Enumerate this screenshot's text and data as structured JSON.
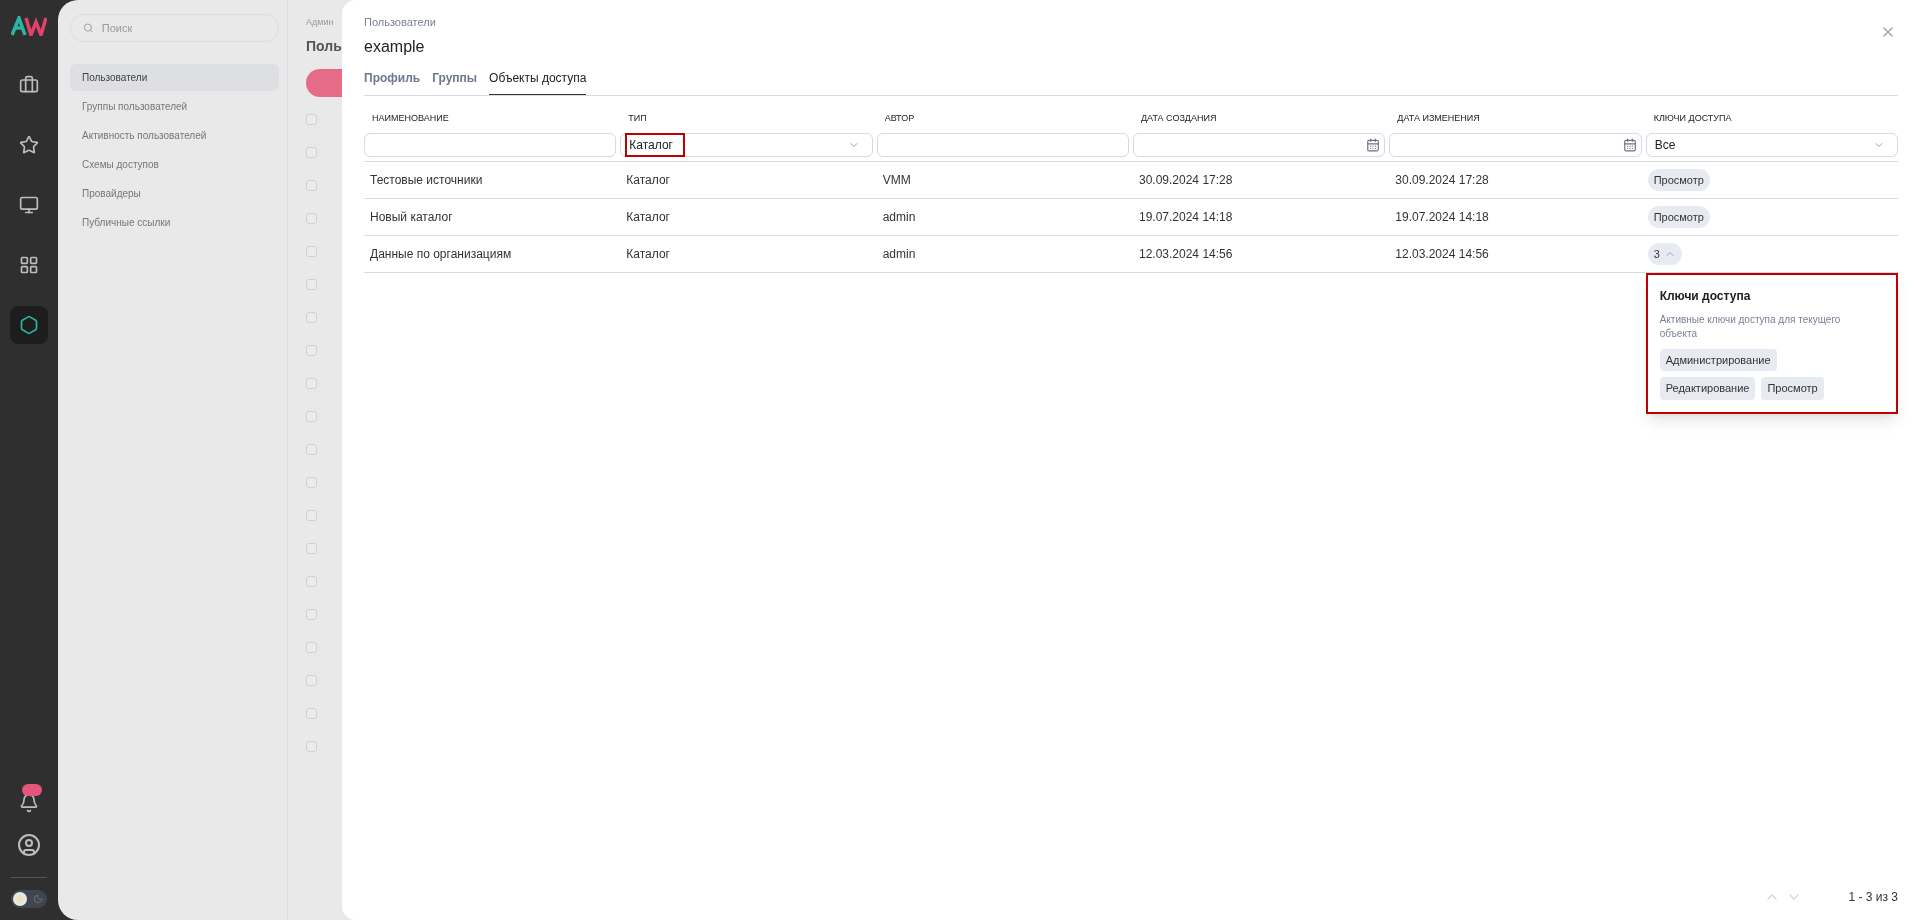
{
  "rail": {
    "items": [
      {
        "kind": "briefcase",
        "selected": false
      },
      {
        "kind": "star",
        "selected": false
      },
      {
        "kind": "screen",
        "selected": false
      },
      {
        "kind": "grid",
        "selected": false
      },
      {
        "kind": "hexagon",
        "selected": true
      }
    ]
  },
  "sidebar": {
    "search": {
      "placeholder": "Поиск"
    },
    "items": [
      {
        "label": "Пользователи",
        "selected": true
      },
      {
        "label": "Группы пользователей",
        "selected": false
      },
      {
        "label": "Активность пользователей",
        "selected": false
      },
      {
        "label": "Схемы доступов",
        "selected": false
      },
      {
        "label": "Провайдеры",
        "selected": false
      },
      {
        "label": "Публичные ссылки",
        "selected": false
      }
    ]
  },
  "theme_toggle": {
    "on": false
  },
  "background_page": {
    "breadcrumb": "Админ",
    "title": "Поль",
    "checkboxes": [
      {
        "checked": false
      },
      {
        "checked": false
      },
      {
        "checked": false
      },
      {
        "checked": false
      },
      {
        "checked": false
      },
      {
        "checked": false
      },
      {
        "checked": false
      },
      {
        "checked": false
      },
      {
        "checked": false
      },
      {
        "checked": false
      },
      {
        "checked": false
      },
      {
        "checked": false
      },
      {
        "checked": false
      },
      {
        "checked": false
      },
      {
        "checked": false
      },
      {
        "checked": false
      },
      {
        "checked": false
      },
      {
        "checked": false
      },
      {
        "checked": false
      },
      {
        "checked": false
      }
    ]
  },
  "drawer": {
    "breadcrumb": "Пользователи",
    "title": "example",
    "tabs": [
      {
        "label": "Профиль",
        "selected": false
      },
      {
        "label": "Группы",
        "selected": false
      },
      {
        "label": "Объекты доступа",
        "selected": true
      }
    ],
    "table": {
      "columns": [
        {
          "label": "НАИМЕНОВАНИЕ",
          "filter": {
            "kind": "text"
          }
        },
        {
          "label": "ТИП",
          "filter": {
            "kind": "select",
            "value": "Каталог",
            "highlighted": true
          }
        },
        {
          "label": "АВТОР",
          "filter": {
            "kind": "text"
          }
        },
        {
          "label": "ДАТА СОЗДАНИЯ",
          "filter": {
            "kind": "date"
          }
        },
        {
          "label": "ДАТА ИЗМЕНЕНИЯ",
          "filter": {
            "kind": "date"
          }
        },
        {
          "label": "КЛЮЧИ ДОСТУПА",
          "filter": {
            "kind": "select",
            "value": "Все",
            "highlighted": false
          }
        }
      ],
      "rows": [
        {
          "cells": [
            "Тестовые источники",
            "Каталог",
            "VMM",
            "30.09.2024 17:28",
            "30.09.2024 17:28"
          ],
          "keys": {
            "kind": "tags",
            "tags": [
              "Просмотр"
            ]
          }
        },
        {
          "cells": [
            "Новый каталог",
            "Каталог",
            "admin",
            "19.07.2024 14:18",
            "19.07.2024 14:18"
          ],
          "keys": {
            "kind": "tags",
            "tags": [
              "Просмотр"
            ]
          }
        },
        {
          "cells": [
            "Данные по организациям",
            "Каталог",
            "admin",
            "12.03.2024 14:56",
            "12.03.2024 14:56"
          ],
          "keys": {
            "kind": "count",
            "count": "3",
            "expanded": true
          }
        }
      ]
    },
    "popover": {
      "title": "Ключи доступа",
      "description": "Активные ключи доступа для текущего объекта",
      "tags": [
        "Администрирование",
        "Редактирование",
        "Просмотр"
      ]
    },
    "pagination": {
      "range": "1 - 3 из 3"
    }
  }
}
